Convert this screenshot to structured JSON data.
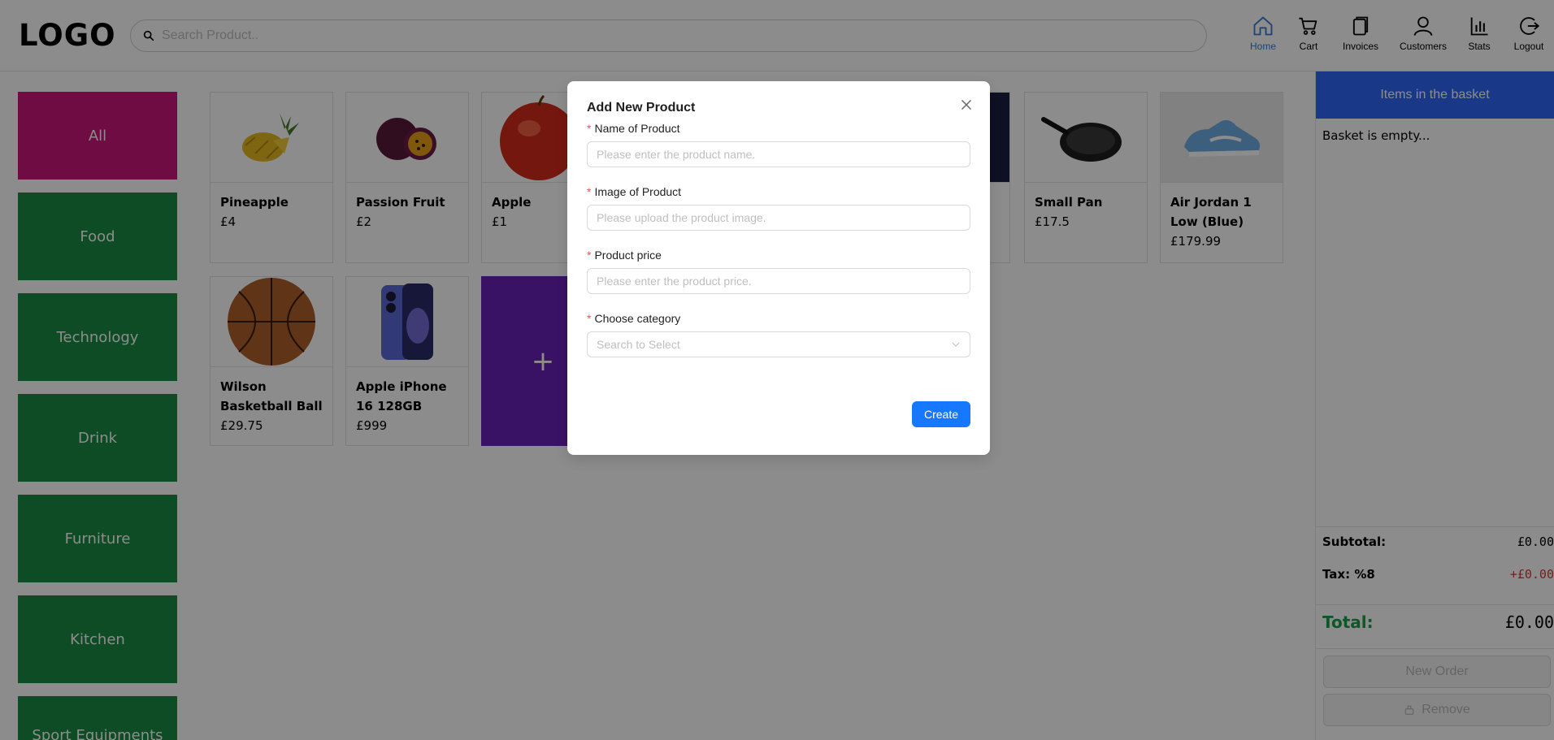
{
  "header": {
    "logo": "LOGO",
    "search_placeholder": "Search Product..",
    "nav": [
      {
        "label": "Home",
        "icon": "home-icon",
        "active": true
      },
      {
        "label": "Cart",
        "icon": "cart-icon"
      },
      {
        "label": "Invoices",
        "icon": "invoice-icon"
      },
      {
        "label": "Customers",
        "icon": "user-icon"
      },
      {
        "label": "Stats",
        "icon": "bar-chart-icon"
      },
      {
        "label": "Logout",
        "icon": "logout-icon"
      }
    ]
  },
  "categories": [
    "All",
    "Food",
    "Technology",
    "Drink",
    "Furniture",
    "Kitchen",
    "Sport Equipments"
  ],
  "products": [
    {
      "name": "Pineapple",
      "price": "£4"
    },
    {
      "name": "Passion Fruit",
      "price": "£2"
    },
    {
      "name": "Apple",
      "price": "£1"
    },
    {
      "name": "Small Pan",
      "price": "£17.5"
    },
    {
      "name": "Air Jordan 1 Low (Blue)",
      "price": "£179.99"
    },
    {
      "name": "Wilson Basketball Ball",
      "price": "£29.75"
    },
    {
      "name": "Apple iPhone 16 128GB",
      "price": "£999"
    }
  ],
  "add_product_symbol": "+",
  "basket": {
    "title": "Items in the basket",
    "empty_text": "Basket is empty...",
    "subtotal_label": "Subtotal:",
    "subtotal_value": "£0.00",
    "tax_label": "Tax: %8",
    "tax_value": "+£0.00",
    "total_label": "Total:",
    "total_value": "£0.00",
    "new_order_label": "New Order",
    "remove_label": "Remove"
  },
  "modal": {
    "title": "Add New Product",
    "fields": [
      {
        "label": "Name of Product",
        "placeholder": "Please enter the product name."
      },
      {
        "label": "Image of Product",
        "placeholder": "Please upload the product image."
      },
      {
        "label": "Product price",
        "placeholder": "Please enter the product price."
      }
    ],
    "category_label": "Choose category",
    "category_placeholder": "Search to Select",
    "create_label": "Create"
  },
  "colors": {
    "category_active": "#c8167a",
    "category": "#188a42",
    "basket_header": "#2f67f6",
    "add_card": "#6a22b8",
    "primary_button": "#1677ff",
    "total_green": "#1e9e4a",
    "tax_red": "#d83a3a"
  }
}
